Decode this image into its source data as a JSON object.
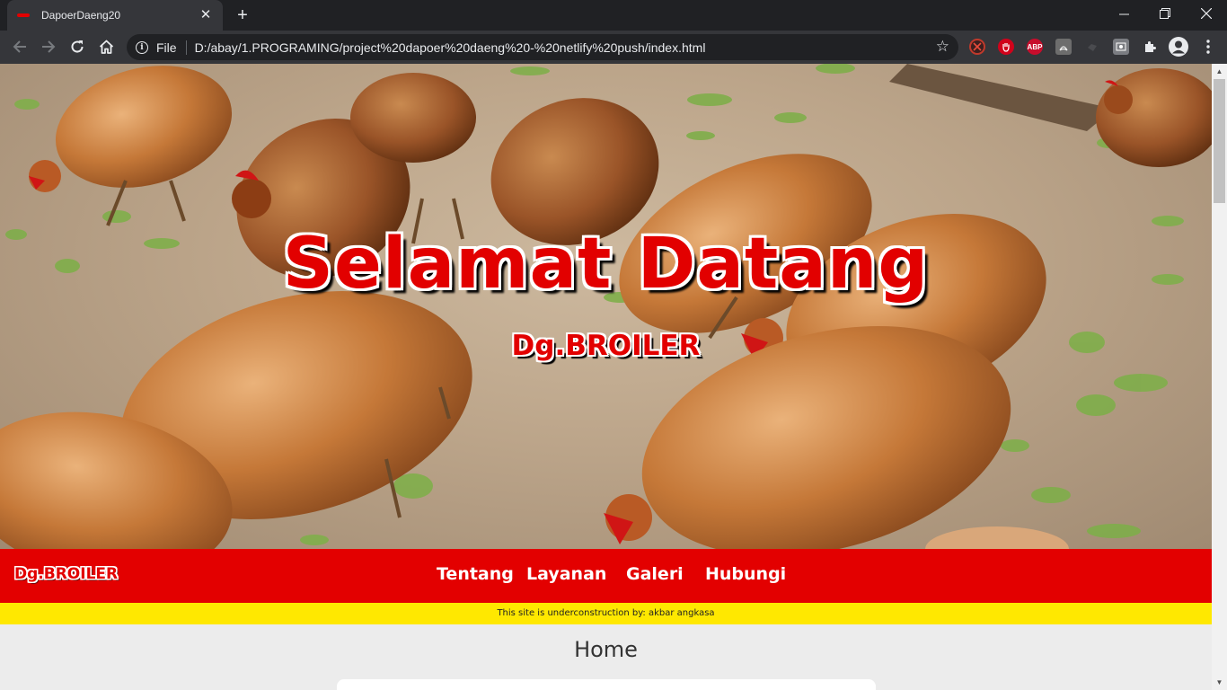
{
  "browser": {
    "tab_title": "DapoerDaeng20",
    "new_tab_symbol": "+",
    "scheme_label": "File",
    "url": "D:/abay/1.PROGRAMING/project%20dapoer%20daeng%20-%20netlify%20push/index.html"
  },
  "extensions": [
    "no-entry-icon",
    "stop-hand-icon",
    "adblock-plus-icon",
    "pdf-icon",
    "dark-extension-icon",
    "photo-extension-icon",
    "puzzle-icon",
    "profile-icon",
    "kebab-menu-icon"
  ],
  "hero": {
    "title": "Selamat Datang",
    "subtitle": "Dg.BROILER"
  },
  "navbar": {
    "logo": "Dg.BROILER",
    "links": [
      "Tentang",
      "Layanan",
      "Galeri",
      "Hubungi"
    ]
  },
  "notice": "This site is underconstruction by: akbar angkasa",
  "section": {
    "title": "Home"
  },
  "colors": {
    "brand_red": "#e30000",
    "notice_yellow": "#ffe800",
    "page_bg": "#ececec",
    "chrome_dark": "#202124",
    "chrome_toolbar": "#35363a"
  }
}
